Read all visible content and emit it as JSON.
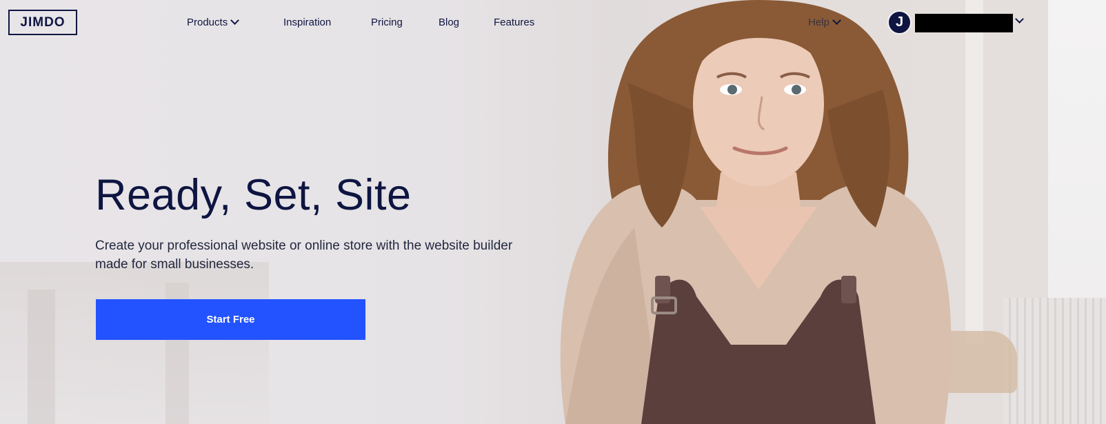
{
  "header": {
    "logo": "JIMDO",
    "nav": [
      {
        "label": "Products",
        "has_dropdown": true
      },
      {
        "label": "Inspiration"
      },
      {
        "label": "Pricing"
      },
      {
        "label": "Blog"
      },
      {
        "label": "Features"
      }
    ],
    "help_label": "Help",
    "avatar_initial": "J"
  },
  "hero": {
    "headline": "Ready, Set, Site",
    "subtext": "Create your professional website or online store with the website builder made for small businesses.",
    "cta_label": "Start Free"
  },
  "colors": {
    "primary_text": "#0e1541",
    "cta_blue": "#2253ff"
  },
  "icons": [
    "chevron-down-icon",
    "avatar-icon"
  ]
}
